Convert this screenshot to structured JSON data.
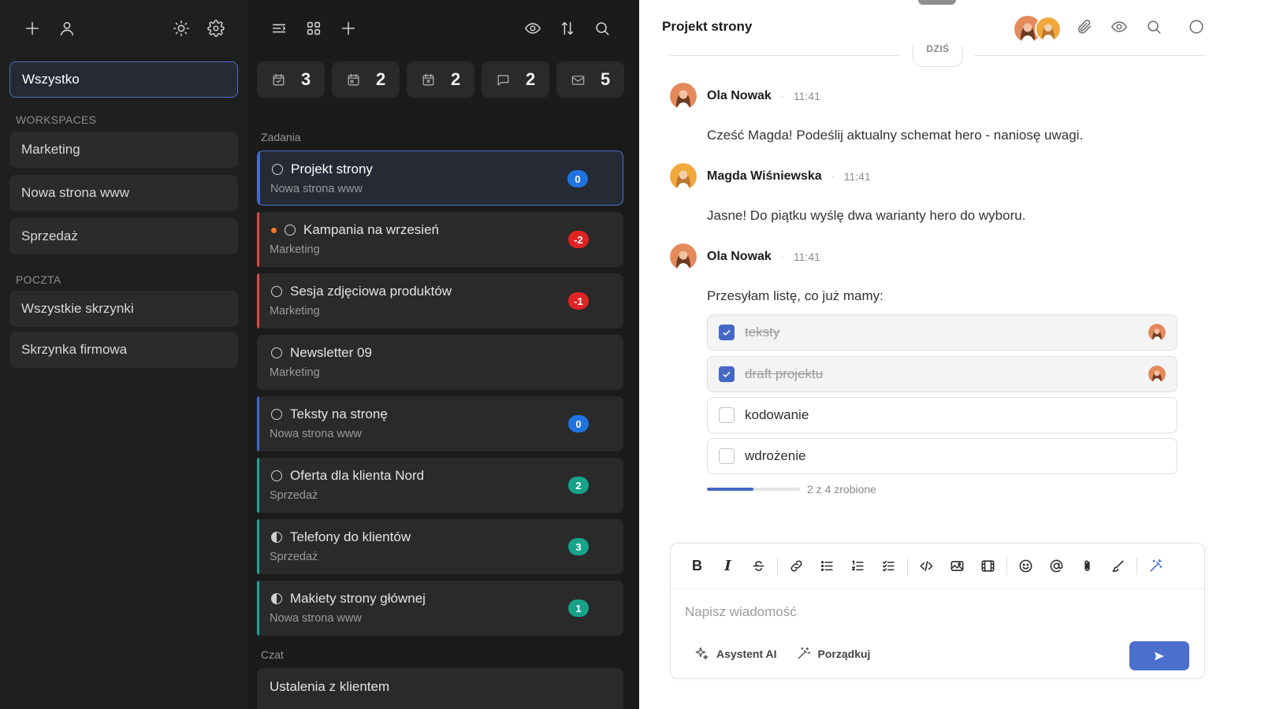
{
  "colors": {
    "accent": "#4b6fcd",
    "badge_blue": "#1f73e0",
    "badge_red": "#e02323",
    "badge_teal": "#16a38a",
    "bar_blue": "#3d6bd3",
    "bar_red": "#e04848",
    "bar_teal": "#1ca497"
  },
  "sidebar": {
    "top_icons": [
      "plus-icon",
      "user-icon",
      "sun-icon",
      "gear-icon"
    ],
    "all_label": "Wszystko",
    "workspaces_header": "WORKSPACES",
    "workspaces": [
      {
        "label": "Marketing"
      },
      {
        "label": "Nowa strona www"
      },
      {
        "label": "Sprzedaż"
      }
    ],
    "mail_header": "POCZTA",
    "mail_items": [
      {
        "label": "Wszystkie skrzynki"
      },
      {
        "label": "Skrzynka firmowa"
      }
    ]
  },
  "middle": {
    "top_icons_left": [
      "filter-lines-icon",
      "grid-icon",
      "plus-icon"
    ],
    "top_icons_right": [
      "eye-icon",
      "sort-icon",
      "search-icon"
    ],
    "stats": [
      {
        "icon": "calendar-check-icon",
        "value": "3"
      },
      {
        "icon": "calendar-icon",
        "value": "2"
      },
      {
        "icon": "calendar-x-icon",
        "value": "2"
      },
      {
        "icon": "chat-icon",
        "value": "2"
      },
      {
        "icon": "mail-icon",
        "value": "5"
      }
    ],
    "tasks_header": "Zadania",
    "tasks": [
      {
        "title": "Projekt strony",
        "sub": "Nowa strona www",
        "badge": "0"
      },
      {
        "title": "Kampania na wrzesień",
        "sub": "Marketing",
        "badge": "-2"
      },
      {
        "title": "Sesja zdjęciowa produktów",
        "sub": "Marketing",
        "badge": "-1"
      },
      {
        "title": "Newsletter 09",
        "sub": "Marketing",
        "badge": ""
      },
      {
        "title": "Teksty na stronę",
        "sub": "Nowa strona www",
        "badge": "0"
      },
      {
        "title": "Oferta dla klienta Nord",
        "sub": "Sprzedaż",
        "badge": "2"
      },
      {
        "title": "Telefony do klientów",
        "sub": "Sprzedaż",
        "badge": "3"
      },
      {
        "title": "Makiety strony głównej",
        "sub": "Nowa strona www",
        "badge": "1"
      }
    ],
    "chat_header": "Czat",
    "chats": [
      {
        "title": "Ustalenia z klientem"
      }
    ]
  },
  "panel": {
    "title": "Projekt strony",
    "header_icons": [
      "paperclip-icon",
      "eye-icon",
      "search-icon",
      "circle-icon"
    ],
    "day_label": "DZIŚ",
    "messages": [
      {
        "author": "Ola Nowak",
        "time": "11:41",
        "text": "Cześć Magda! Podeślij aktualny schemat hero - naniosę uwagi."
      },
      {
        "author": "Magda Wiśniewska",
        "time": "11:41",
        "text": "Jasne! Do piątku wyślę dwa warianty hero do wyboru."
      },
      {
        "author": "Ola Nowak",
        "time": "11:41",
        "text": "Przesyłam listę, co już mamy:"
      }
    ],
    "checklist": [
      {
        "label": "teksty",
        "done": true
      },
      {
        "label": "draft projektu",
        "done": true
      },
      {
        "label": "kodowanie",
        "done": false
      },
      {
        "label": "wdrożenie",
        "done": false
      }
    ],
    "progress_done": 2,
    "progress_total": 4,
    "progress_label": "2 z 4 zrobione",
    "composer": {
      "placeholder": "Napisz wiadomość",
      "toolbar": [
        "bold-icon",
        "italic-icon",
        "strikethrough-icon",
        "link-icon",
        "bullet-list-icon",
        "numbered-list-icon",
        "task-list-icon",
        "code-icon",
        "image-icon",
        "video-icon",
        "emoji-icon",
        "mention-icon",
        "attach-icon",
        "brush-icon",
        "magic-wand-icon"
      ],
      "ai_label": "Asystent AI",
      "tidy_label": "Porządkuj"
    }
  }
}
